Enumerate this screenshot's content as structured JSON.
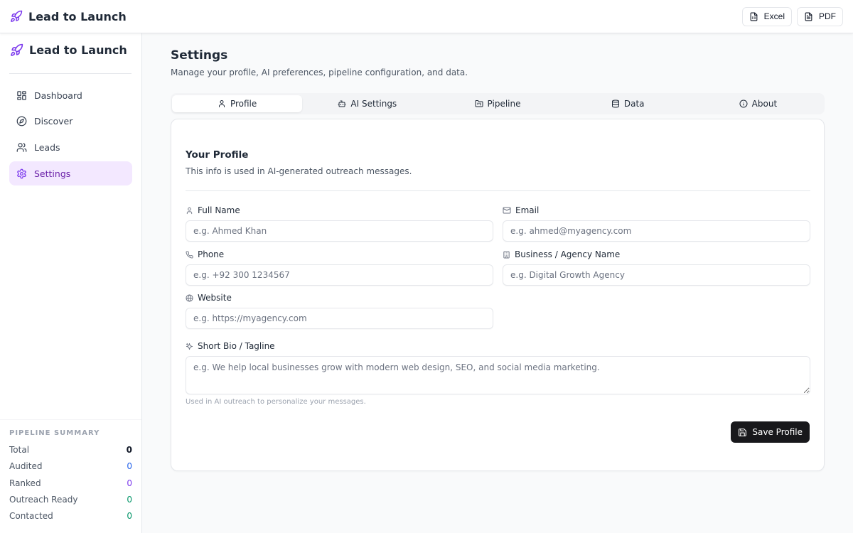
{
  "app": {
    "name": "Lead to Launch"
  },
  "topbar": {
    "excel_label": "Excel",
    "pdf_label": "PDF"
  },
  "sidebar": {
    "brand": "Lead to Launch",
    "items": [
      {
        "label": "Dashboard",
        "icon": "dashboard-icon"
      },
      {
        "label": "Discover",
        "icon": "compass-icon"
      },
      {
        "label": "Leads",
        "icon": "users-icon"
      },
      {
        "label": "Settings",
        "icon": "gear-icon",
        "active": true
      }
    ],
    "summary": {
      "title": "PIPELINE SUMMARY",
      "rows": [
        {
          "label": "Total",
          "value": "0"
        },
        {
          "label": "Audited",
          "value": "0"
        },
        {
          "label": "Ranked",
          "value": "0"
        },
        {
          "label": "Outreach Ready",
          "value": "0"
        },
        {
          "label": "Contacted",
          "value": "0"
        }
      ]
    }
  },
  "page": {
    "title": "Settings",
    "subtitle": "Manage your profile, AI preferences, pipeline configuration, and data."
  },
  "tabs": [
    {
      "label": "Profile",
      "icon": "user-icon",
      "active": true
    },
    {
      "label": "AI Settings",
      "icon": "bot-icon"
    },
    {
      "label": "Pipeline",
      "icon": "folder-kanban-icon"
    },
    {
      "label": "Data",
      "icon": "database-icon"
    },
    {
      "label": "About",
      "icon": "info-icon"
    }
  ],
  "profile": {
    "title": "Your Profile",
    "description": "This info is used in AI-generated outreach messages.",
    "fields": {
      "full_name": {
        "label": "Full Name",
        "placeholder": "e.g. Ahmed Khan",
        "value": ""
      },
      "email": {
        "label": "Email",
        "placeholder": "e.g. ahmed@myagency.com",
        "value": ""
      },
      "phone": {
        "label": "Phone",
        "placeholder": "e.g. +92 300 1234567",
        "value": ""
      },
      "business": {
        "label": "Business / Agency Name",
        "placeholder": "e.g. Digital Growth Agency",
        "value": ""
      },
      "website": {
        "label": "Website",
        "placeholder": "e.g. https://myagency.com",
        "value": ""
      },
      "bio": {
        "label": "Short Bio / Tagline",
        "placeholder": "e.g. We help local businesses grow with modern web design, SEO, and social media marketing.",
        "value": ""
      }
    },
    "bio_hint": "Used in AI outreach to personalize your messages.",
    "save_label": "Save Profile"
  },
  "colors": {
    "accent": "#7c3aed",
    "active_bg": "#f3e8ff",
    "save_button": "#18181b",
    "audited": "#2563eb",
    "ranked": "#7c3aed",
    "outreach_ready": "#059669",
    "contacted": "#059669"
  }
}
